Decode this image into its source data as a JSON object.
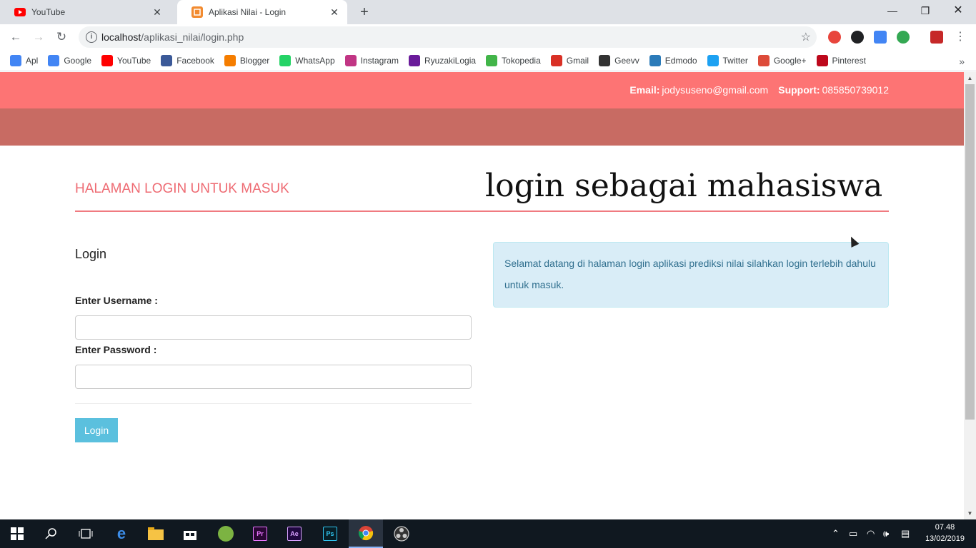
{
  "browser": {
    "tabs": [
      {
        "title": "YouTube",
        "icon": "youtube-icon",
        "active": false
      },
      {
        "title": "Aplikasi Nilai - Login",
        "icon": "page-icon",
        "active": true
      }
    ],
    "url_host": "localhost",
    "url_path": "/aplikasi_nilai/login.php",
    "bookmarks": [
      {
        "label": "Apl",
        "icon": "apps-grid-icon",
        "color": "#4285f4"
      },
      {
        "label": "Google",
        "icon": "google-icon",
        "color": "#4285f4"
      },
      {
        "label": "YouTube",
        "icon": "youtube-icon",
        "color": "#ff0000"
      },
      {
        "label": "Facebook",
        "icon": "facebook-icon",
        "color": "#3b5998"
      },
      {
        "label": "Blogger",
        "icon": "blogger-icon",
        "color": "#f57d00"
      },
      {
        "label": "WhatsApp",
        "icon": "whatsapp-icon",
        "color": "#25d366"
      },
      {
        "label": "Instagram",
        "icon": "instagram-icon",
        "color": "#c13584"
      },
      {
        "label": "RyuzakiLogia",
        "icon": "rl-icon",
        "color": "#6a1b9a"
      },
      {
        "label": "Tokopedia",
        "icon": "tokopedia-icon",
        "color": "#42b549"
      },
      {
        "label": "Gmail",
        "icon": "gmail-icon",
        "color": "#d93025"
      },
      {
        "label": "Geevv",
        "icon": "geevv-icon",
        "color": "#333333"
      },
      {
        "label": "Edmodo",
        "icon": "edmodo-icon",
        "color": "#2b7bb9"
      },
      {
        "label": "Twitter",
        "icon": "twitter-icon",
        "color": "#1da1f2"
      },
      {
        "label": "Google+",
        "icon": "google-plus-icon",
        "color": "#dd4b39"
      },
      {
        "label": "Pinterest",
        "icon": "pinterest-icon",
        "color": "#bd081c"
      }
    ],
    "bookmarks_more": "»"
  },
  "page": {
    "email_label": "Email:",
    "email_value": "jodysuseno@gmail.com",
    "support_label": "Support:",
    "support_value": "085850739012",
    "heading": "HALAMAN LOGIN UNTUK MASUK",
    "overlay_title": "login sebagai mahasiswa",
    "login_title": "Login",
    "username_label": "Enter Username :",
    "username_value": "",
    "password_label": "Enter Password :",
    "password_value": "",
    "login_button": "Login",
    "alert_text": "Selamat datang di halaman login aplikasi prediksi nilai silahkan login terlebih dahulu untuk masuk.",
    "colors": {
      "topbar": "#fd7474",
      "subbar": "#c86b63",
      "heading": "#ee6b73",
      "button": "#5bc0de",
      "alert_bg": "#d9edf7"
    }
  },
  "taskbar": {
    "time": "07.48",
    "date": "13/02/2019",
    "apps": [
      "windows-start-icon",
      "search-icon",
      "task-view-icon",
      "edge-icon",
      "file-explorer-icon",
      "store-icon",
      "globe-app-icon",
      "premiere-icon",
      "after-effects-icon",
      "photoshop-icon",
      "chrome-icon",
      "obs-icon"
    ]
  }
}
